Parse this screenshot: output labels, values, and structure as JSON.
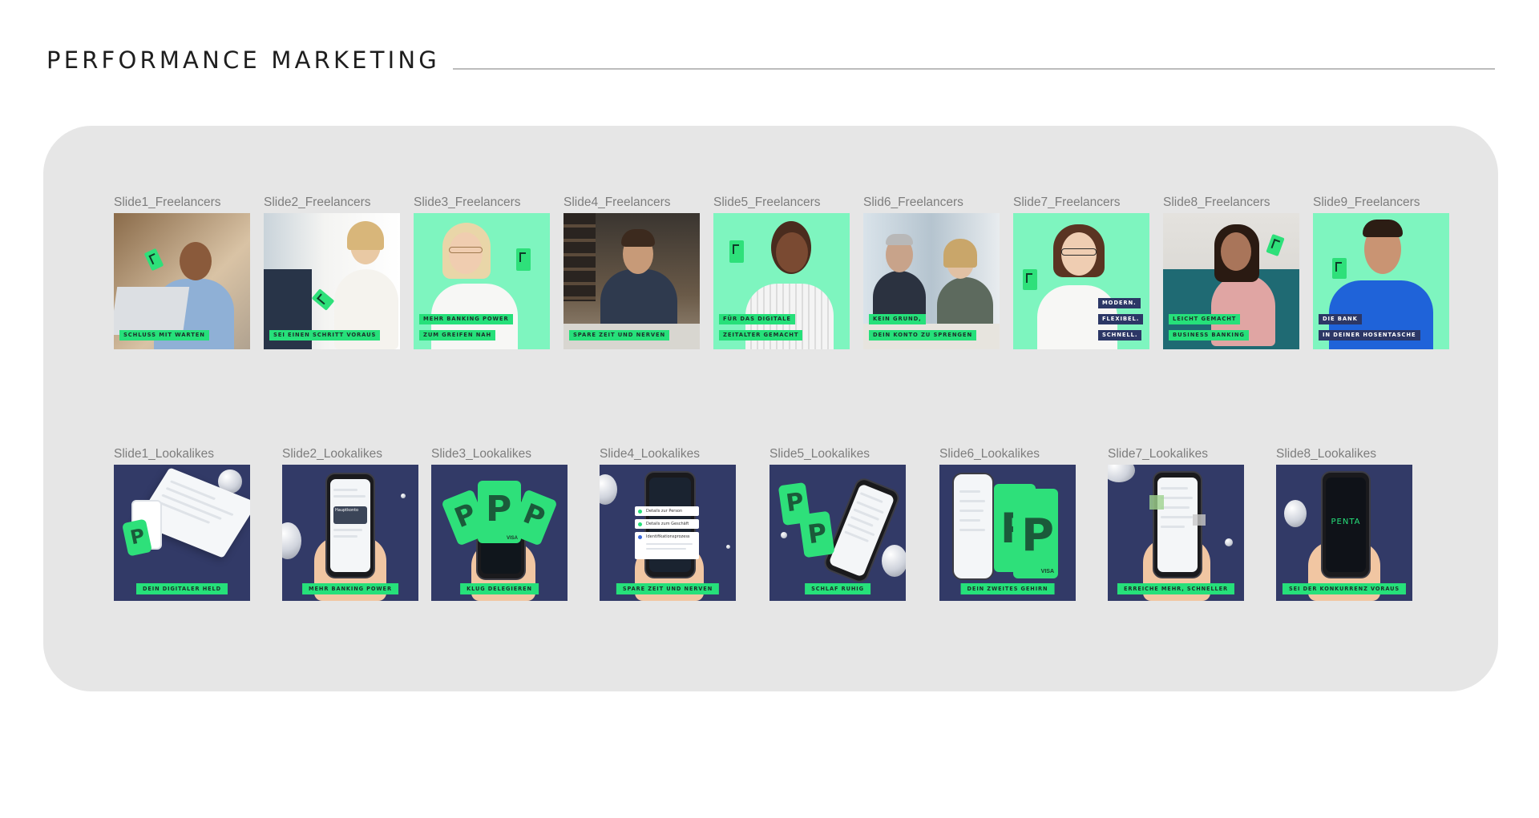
{
  "header": {
    "title": "PERFORMANCE MARKETING"
  },
  "freelancers": [
    {
      "label": "Slide1_Freelancers",
      "tags": [
        {
          "text": "SCHLUSS MIT WARTEN",
          "style": "green"
        }
      ]
    },
    {
      "label": "Slide2_Freelancers",
      "tags": [
        {
          "text": "SEI EINEN SCHRITT VORAUS",
          "style": "green"
        }
      ]
    },
    {
      "label": "Slide3_Freelancers",
      "tags": [
        {
          "text": "MEHR BANKING POWER",
          "style": "green"
        },
        {
          "text": "ZUM GREIFEN NAH",
          "style": "green"
        }
      ]
    },
    {
      "label": "Slide4_Freelancers",
      "tags": [
        {
          "text": "SPARE ZEIT UND NERVEN",
          "style": "green"
        }
      ]
    },
    {
      "label": "Slide5_Freelancers",
      "tags": [
        {
          "text": "FÜR DAS DIGITALE",
          "style": "green"
        },
        {
          "text": "ZEITALTER GEMACHT",
          "style": "green"
        }
      ]
    },
    {
      "label": "Slid6_Freelancers",
      "tags": [
        {
          "text": "KEIN GRUND,",
          "style": "green"
        },
        {
          "text": "DEIN KONTO ZU SPRENGEN",
          "style": "green"
        }
      ]
    },
    {
      "label": "Slide7_Freelancers",
      "tags": [
        {
          "text": "MODERN.",
          "style": "navy"
        },
        {
          "text": "FLEXIBEL.",
          "style": "navy"
        },
        {
          "text": "SCHNELL.",
          "style": "navy"
        }
      ]
    },
    {
      "label": "Slide8_Freelancers",
      "tags": [
        {
          "text": "LEICHT GEMACHT",
          "style": "green"
        },
        {
          "text": "BUSINESS BANKING",
          "style": "green"
        }
      ]
    },
    {
      "label": "Slide9_Freelancers",
      "tags": [
        {
          "text": "DIE BANK",
          "style": "navy"
        },
        {
          "text": "IN DEINER HOSENTASCHE",
          "style": "navy"
        }
      ]
    }
  ],
  "lookalikes": [
    {
      "label": "Slide1_Lookalikes",
      "tag": "DEIN DIGITALER HELD"
    },
    {
      "label": "Slide2_Lookalikes",
      "tag": "MEHR BANKING POWER"
    },
    {
      "label": "Slide3_Lookalikes",
      "tag": "KLUG DELEGIEREN"
    },
    {
      "label": "Slide4_Lookalikes",
      "tag": "SPARE ZEIT UND NERVEN"
    },
    {
      "label": "Slide5_Lookalikes",
      "tag": "SCHLAF RUHIG"
    },
    {
      "label": "Slide6_Lookalikes",
      "tag": "DEIN ZWEITES GEHIRN"
    },
    {
      "label": "Slide7_Lookalikes",
      "tag": "ERREICHE MEHR, SCHNELLER"
    },
    {
      "label": "Slide8_Lookalikes",
      "tag": "SEI DER KONKURRENZ VORAUS"
    }
  ],
  "mockup_text": {
    "hauptkonto": "Hauptkonto",
    "steps": [
      "Details zur Person",
      "Details zum Geschäft",
      "Identifikationsprozess"
    ],
    "brand": "PENTA",
    "visa": "VISA"
  },
  "colors": {
    "brand_green": "#26e07a",
    "navy": "#323a67",
    "panel": "#e6e6e6"
  }
}
